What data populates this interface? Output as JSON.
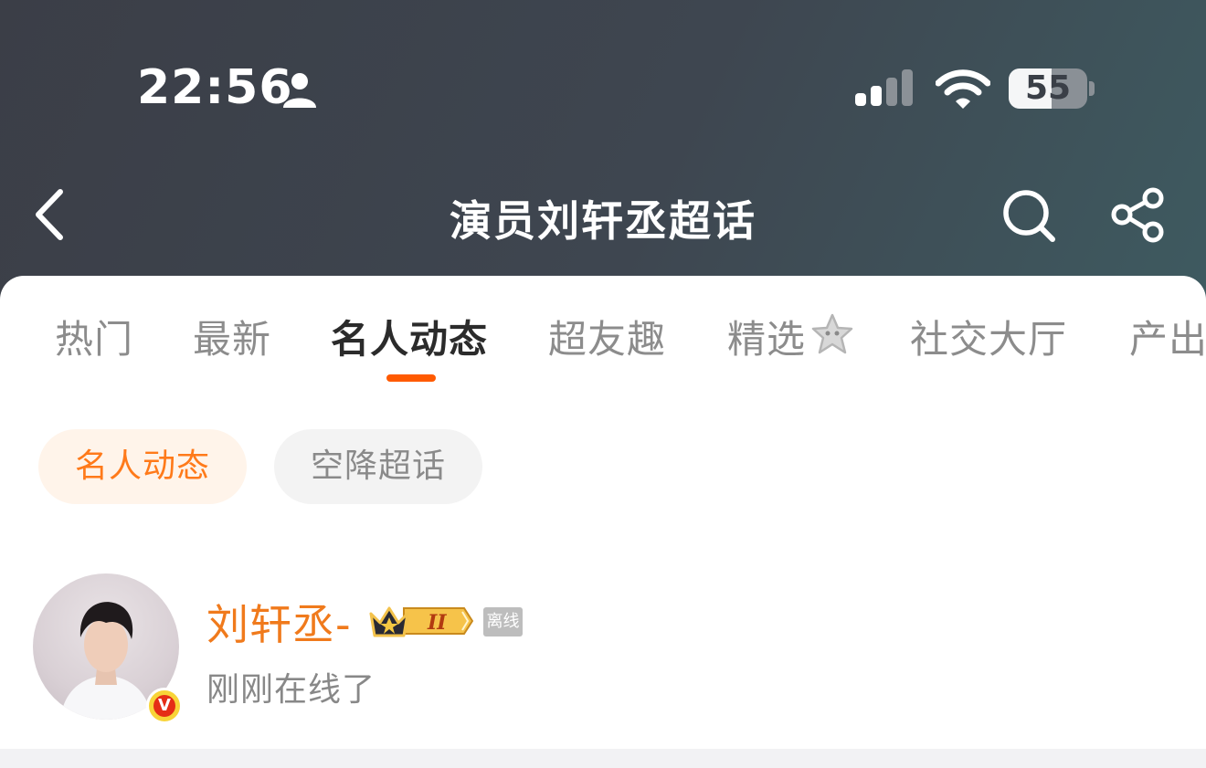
{
  "status_bar": {
    "time": "22:56",
    "battery": "55",
    "icons": [
      "person-icon",
      "cellular-signal-icon",
      "wifi-icon",
      "battery-icon"
    ]
  },
  "nav": {
    "title": "演员刘轩丞超话",
    "icons": [
      "back-icon",
      "search-icon",
      "share-icon"
    ]
  },
  "tabs": [
    {
      "label": "热门",
      "active": false
    },
    {
      "label": "最新",
      "active": false
    },
    {
      "label": "名人动态",
      "active": true
    },
    {
      "label": "超友趣",
      "active": false
    },
    {
      "label": "精选",
      "active": false
    },
    {
      "label": "社交大厅",
      "active": false
    },
    {
      "label": "产出",
      "active": false
    }
  ],
  "chips": [
    {
      "label": "名人动态",
      "active": true
    },
    {
      "label": "空降超话",
      "active": false
    }
  ],
  "user": {
    "name": "刘轩丞-",
    "level_badge": "II",
    "offline_tag": "离线",
    "status": "刚刚在线了",
    "verified_mark": "V"
  },
  "colors": {
    "accent": "#ff5a00",
    "name_orange": "#f07a1c",
    "chip_active_bg": "#fff4ea",
    "header_bg": "#3e4650"
  }
}
